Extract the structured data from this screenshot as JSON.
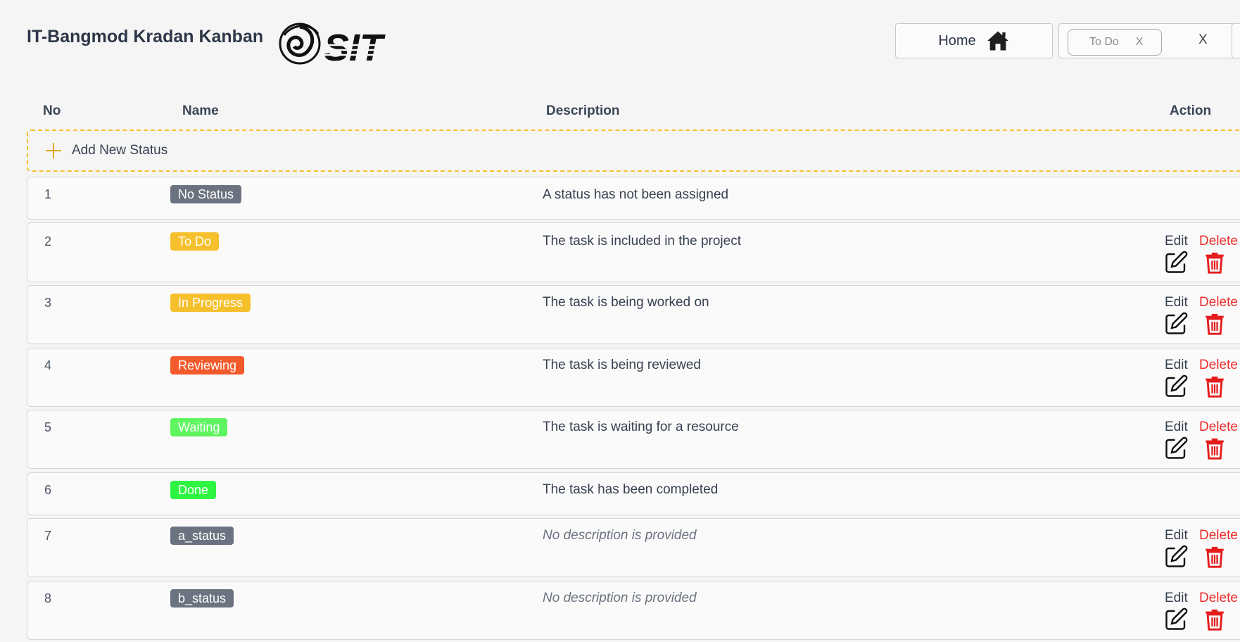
{
  "header": {
    "app_title": "IT-Bangmod Kradan Kanban",
    "logo_text": "SIT",
    "home_label": "Home",
    "filter_chip": "To Do",
    "filter_chip_remove": "X",
    "filter_clear": "X"
  },
  "table": {
    "headers": {
      "no": "No",
      "name": "Name",
      "description": "Description",
      "action": "Action"
    },
    "add_label": "Add New Status",
    "edit_label": "Edit",
    "delete_label": "Delete",
    "rows": [
      {
        "no": "1",
        "name": "No Status",
        "color": "#6b7280",
        "description": "A status has not been assigned"
      },
      {
        "no": "2",
        "name": "To Do",
        "color": "#f6c02d",
        "description": "The task is included in the project"
      },
      {
        "no": "3",
        "name": "In Progress",
        "color": "#f6c02d",
        "description": "The task is being worked on"
      },
      {
        "no": "4",
        "name": "Reviewing",
        "color": "#f35a2b",
        "description": "The task is being reviewed"
      },
      {
        "no": "5",
        "name": "Waiting",
        "color": "#5ef560",
        "description": "The task is waiting for a resource"
      },
      {
        "no": "6",
        "name": "Done",
        "color": "#2ef542",
        "description": "The task has been completed"
      },
      {
        "no": "7",
        "name": "a_status",
        "color": "#6b7280",
        "description": "No description is provided"
      },
      {
        "no": "8",
        "name": "b_status",
        "color": "#6b7280",
        "description": "No description is provided"
      }
    ]
  }
}
